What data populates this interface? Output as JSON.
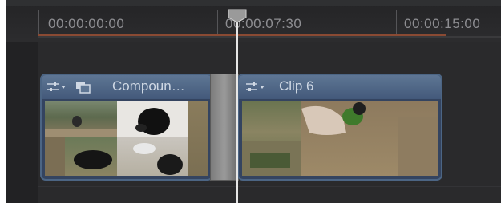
{
  "ruler": {
    "timecodes": [
      "00:00:00:00",
      "00:00:07:30",
      "00:00:15:00"
    ]
  },
  "clips": [
    {
      "title": "Compoun…",
      "type": "compound"
    },
    {
      "title": "Clip 6",
      "type": "video"
    }
  ],
  "colors": {
    "timeline_bg": "#2b2b2d",
    "clip_header": "#5e7694",
    "clip_border": "#4c6584",
    "range_bar": "#8a4a33",
    "playhead": "#e6e6e6"
  }
}
